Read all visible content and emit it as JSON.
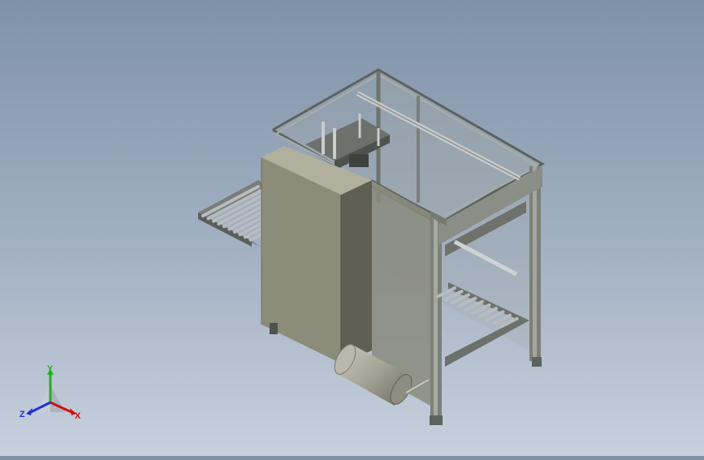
{
  "viewport": {
    "model": "roller-conveyor-wrapping-station"
  },
  "triad": {
    "x_label": "X",
    "y_label": "Y",
    "z_label": "Z",
    "x_color": "#d01010",
    "y_color": "#20b020",
    "z_color": "#2030d0"
  },
  "colors": {
    "background_top": "#7f92a9",
    "background_bottom": "#c7d0dd",
    "panel": "#8c8c7a",
    "frame": "#7c8078",
    "roller": "#b8bcc0"
  }
}
